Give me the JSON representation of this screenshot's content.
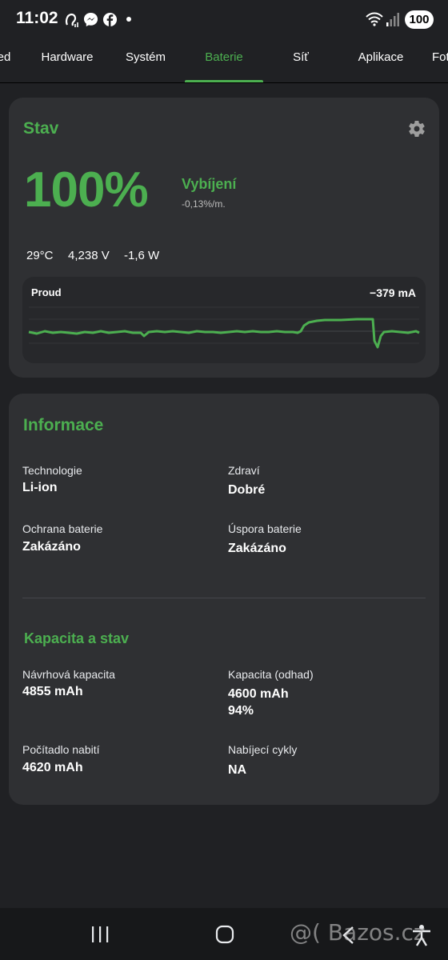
{
  "status_bar": {
    "time": "11:02",
    "battery_level": "100",
    "icons": [
      "hearing-icon",
      "messenger-icon",
      "facebook-icon",
      "dot-icon",
      "wifi-icon",
      "signal-icon"
    ]
  },
  "tabs": [
    {
      "label": "ed"
    },
    {
      "label": "Hardware"
    },
    {
      "label": "Systém"
    },
    {
      "label": "Baterie",
      "active": true
    },
    {
      "label": "Síť"
    },
    {
      "label": "Aplikace"
    },
    {
      "label": "Fot"
    }
  ],
  "status_card": {
    "title": "Stav",
    "percent": "100%",
    "state": "Vybíjení",
    "rate": "-0,13%/m.",
    "temperature": "29°C",
    "voltage": "4,238 V",
    "power": "-1,6 W",
    "graph": {
      "label": "Proud",
      "value": "−379 mA"
    }
  },
  "info_card": {
    "title": "Informace",
    "technology_label": "Technologie",
    "technology_value": "Li-ion",
    "health_label": "Zdraví",
    "health_value": "Dobré",
    "protection_label": "Ochrana baterie",
    "protection_value": "Zakázáno",
    "saver_label": "Úspora baterie",
    "saver_value": "Zakázáno",
    "capacity_title": "Kapacita a stav",
    "design_capacity_label": "Návrhová kapacita",
    "design_capacity_value": "4855 mAh",
    "est_capacity_label": "Kapacita (odhad)",
    "est_capacity_value": "4600 mAh",
    "est_capacity_percent": "94%",
    "charge_counter_label": "Počítadlo nabití",
    "charge_counter_value": "4620 mAh",
    "cycles_label": "Nabíjecí cykly",
    "cycles_value": "NA"
  },
  "nav_bar": {
    "watermark": "@( Bazos.cz"
  },
  "colors": {
    "accent": "#4caf50",
    "background": "#202124",
    "card": "#2f3033"
  }
}
